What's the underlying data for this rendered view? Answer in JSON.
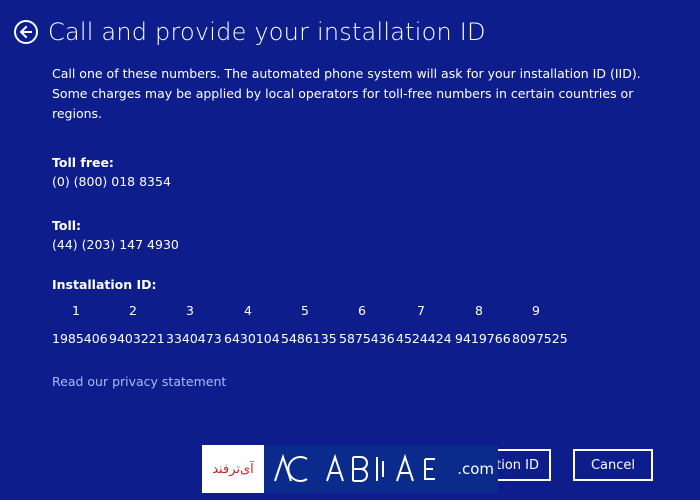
{
  "header": {
    "title": "Call and provide your installation ID"
  },
  "intro": {
    "text": "Call one of these numbers. The automated phone system will ask for your installation ID (IID). Some charges may be applied by local operators for toll-free numbers in certain countries or regions."
  },
  "toll_free": {
    "label": "Toll free:",
    "number": "(0) (800) 018 8354"
  },
  "toll": {
    "label": "Toll:",
    "number": "(44) (203) 147 4930"
  },
  "installation_id": {
    "label": "Installation ID:",
    "columns": [
      "1",
      "2",
      "3",
      "4",
      "5",
      "6",
      "7",
      "8",
      "9"
    ],
    "values": [
      "1985406",
      "9403221",
      "3340473",
      "6430104",
      "5486135",
      "5875436",
      "4524424",
      "9419766",
      "8097525"
    ]
  },
  "privacy_link": "Read our privacy statement",
  "buttons": {
    "primary_visible": "tion ID",
    "cancel": "Cancel"
  },
  "watermark": {
    "text_fa": "آی‌ترفند",
    "dotcom": ".com"
  },
  "colors": {
    "background": "#0d1e8c",
    "link": "#a9b8ff",
    "text": "#ffffff"
  },
  "icons": {
    "back": "back-arrow-icon"
  }
}
